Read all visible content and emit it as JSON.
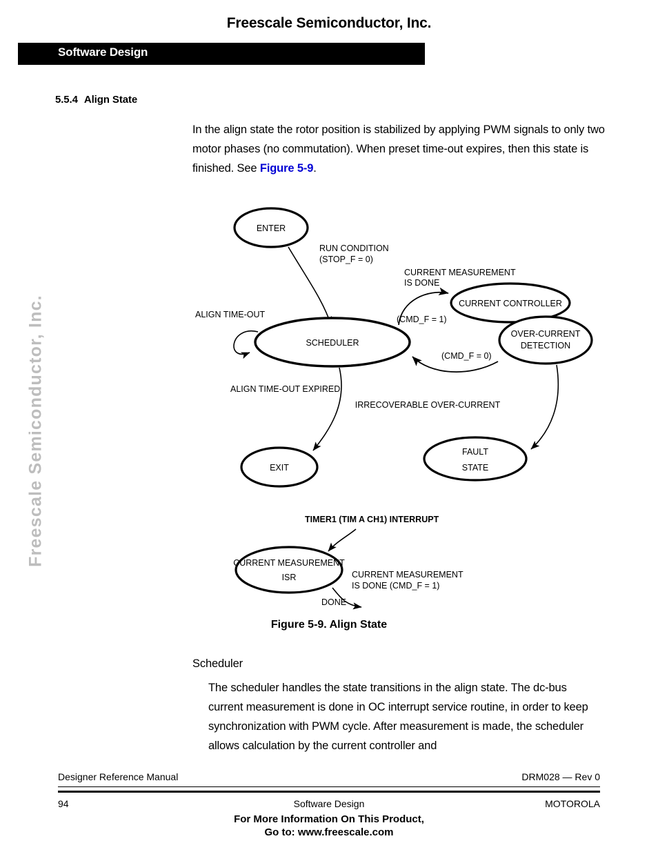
{
  "header": {
    "company": "Freescale Semiconductor, Inc.",
    "chapter_bar_label": "Software Design"
  },
  "side_watermark": "Freescale Semiconductor, Inc.",
  "section": {
    "number": "5.5.4",
    "title": "Align State"
  },
  "intro": {
    "text_before_ref": "In the align state the rotor position is stabilized by applying PWM signals to only two motor phases (no commutation). When preset time-out expires, then this state is finished. See ",
    "figure_ref": "Figure 5-9",
    "text_after_ref": "."
  },
  "figure": {
    "caption": "Figure 5-9. Align State",
    "nodes": {
      "enter": "ENTER",
      "scheduler": "SCHEDULER",
      "current_controller": "CURRENT CONTROLLER",
      "over_current_line1": "OVER-CURRENT",
      "over_current_line2": "DETECTION",
      "exit": "EXIT",
      "fault_line1": "FAULT",
      "fault_line2": "STATE",
      "isr_line1": "CURRENT MEASUREMENT",
      "isr_line2": "ISR"
    },
    "labels": {
      "run_condition_line1": "RUN CONDITION",
      "run_condition_line2": "(STOP_F = 0)",
      "align_timeout": "ALIGN TIME-OUT",
      "current_meas_done_line1": "CURRENT MEASUREMENT",
      "current_meas_done_line2": "IS DONE",
      "cmd_f_1": "(CMD_F = 1)",
      "cmd_f_0": "(CMD_F = 0)",
      "align_timeout_expired": "ALIGN TIME-OUT EXPIRED",
      "irrecoverable": "IRRECOVERABLE OVER-CURRENT",
      "timer1_interrupt": "TIMER1 (TIM A CH1) INTERRUPT",
      "isr_done_line1": "CURRENT MEASUREMENT",
      "isr_done_line2": "IS DONE (CMD_F = 1)",
      "done": "DONE"
    }
  },
  "scheduler_section": {
    "label": "Scheduler",
    "paragraph": "The scheduler handles the state transitions in the align state. The dc-bus current measurement is done in OC interrupt service routine, in order to keep synchronization with PWM cycle. After measurement is made, the scheduler allows calculation by the current controller and"
  },
  "footer": {
    "manual_name": "Designer Reference Manual",
    "doc_rev": "DRM028 — Rev 0",
    "page_number": "94",
    "chapter_name": "Software Design",
    "brand": "MOTOROLA",
    "promo_line1": "For More Information On This Product,",
    "promo_line2": "Go to: www.freescale.com"
  },
  "colors": {
    "figure_ref_blue": "#0000d4",
    "watermark_gray": "#bdbdbd",
    "bar_black": "#000000"
  }
}
